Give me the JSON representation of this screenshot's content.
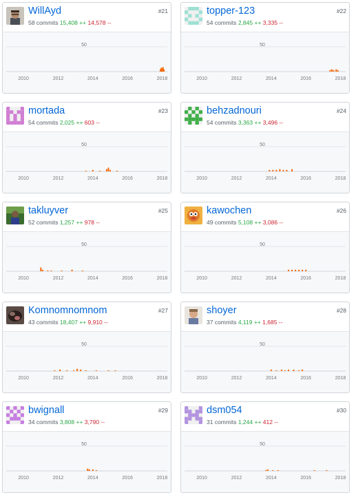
{
  "contributors": [
    {
      "rank": "#21",
      "name": "WillAyd",
      "commits": "58 commits",
      "additions": "15,408 ++",
      "deletions": "14,578 --",
      "avatar": "photo-avatar-icon"
    },
    {
      "rank": "#22",
      "name": "topper-123",
      "commits": "54 commits",
      "additions": "2,845 ++",
      "deletions": "3,335 --",
      "avatar": "identicon-avatar-icon"
    },
    {
      "rank": "#23",
      "name": "mortada",
      "commits": "54 commits",
      "additions": "2,025 ++",
      "deletions": "603 --",
      "avatar": "identicon-avatar-icon"
    },
    {
      "rank": "#24",
      "name": "behzadnouri",
      "commits": "54 commits",
      "additions": "3,363 ++",
      "deletions": "3,496 --",
      "avatar": "identicon-avatar-icon"
    },
    {
      "rank": "#25",
      "name": "takluyver",
      "commits": "52 commits",
      "additions": "1,257 ++",
      "deletions": "978 --",
      "avatar": "photo-avatar-icon"
    },
    {
      "rank": "#26",
      "name": "kawochen",
      "commits": "49 commits",
      "additions": "5,108 ++",
      "deletions": "3,086 --",
      "avatar": "photo-avatar-icon"
    },
    {
      "rank": "#27",
      "name": "Komnomnomnom",
      "commits": "43 commits",
      "additions": "18,407 ++",
      "deletions": "9,910 --",
      "avatar": "photo-avatar-icon"
    },
    {
      "rank": "#28",
      "name": "shoyer",
      "commits": "37 commits",
      "additions": "4,119 ++",
      "deletions": "1,685 --",
      "avatar": "photo-avatar-icon"
    },
    {
      "rank": "#29",
      "name": "bwignall",
      "commits": "34 commits",
      "additions": "3,808 ++",
      "deletions": "3,790 --",
      "avatar": "identicon-avatar-icon"
    },
    {
      "rank": "#30",
      "name": "dsm054",
      "commits": "31 commits",
      "additions": "1,244 ++",
      "deletions": "412 --",
      "avatar": "identicon-avatar-icon"
    }
  ],
  "chart_data": {
    "type": "area",
    "x_ticks": [
      "2010",
      "2012",
      "2014",
      "2016",
      "2018"
    ],
    "y_ticks": [
      "50"
    ],
    "xlim": [
      2009.0,
      2018.3
    ],
    "ylim": [
      0,
      80
    ],
    "series": [
      {
        "activity": [
          [
            2017.9,
            3
          ],
          [
            2017.95,
            5
          ],
          [
            2018.0,
            4
          ],
          [
            2018.05,
            6
          ],
          [
            2018.1,
            3
          ]
        ]
      },
      {
        "activity": [
          [
            2017.4,
            2
          ],
          [
            2017.5,
            3
          ],
          [
            2017.6,
            2
          ],
          [
            2017.75,
            3
          ],
          [
            2017.85,
            2
          ]
        ]
      },
      {
        "activity": [
          [
            2013.6,
            1
          ],
          [
            2014.0,
            2
          ],
          [
            2014.4,
            1
          ],
          [
            2014.8,
            3
          ],
          [
            2014.9,
            5
          ],
          [
            2015.0,
            2
          ],
          [
            2015.4,
            1
          ]
        ]
      },
      {
        "activity": [
          [
            2013.9,
            2
          ],
          [
            2014.1,
            2
          ],
          [
            2014.3,
            2
          ],
          [
            2014.5,
            3
          ],
          [
            2014.7,
            2
          ],
          [
            2014.9,
            2
          ],
          [
            2015.2,
            3
          ]
        ]
      },
      {
        "activity": [
          [
            2011.0,
            5
          ],
          [
            2011.1,
            2
          ],
          [
            2011.4,
            1
          ],
          [
            2011.6,
            1
          ],
          [
            2012.2,
            1
          ],
          [
            2012.8,
            2
          ],
          [
            2013.4,
            1
          ]
        ]
      },
      {
        "activity": [
          [
            2015.0,
            2
          ],
          [
            2015.2,
            2
          ],
          [
            2015.4,
            2
          ],
          [
            2015.6,
            2
          ],
          [
            2015.8,
            2
          ],
          [
            2016.0,
            2
          ]
        ]
      },
      {
        "activity": [
          [
            2011.8,
            1
          ],
          [
            2012.1,
            2
          ],
          [
            2012.5,
            1
          ],
          [
            2012.9,
            1
          ],
          [
            2013.1,
            3
          ],
          [
            2013.3,
            2
          ],
          [
            2013.6,
            1
          ],
          [
            2014.2,
            1
          ],
          [
            2014.9,
            1
          ],
          [
            2015.3,
            1
          ]
        ]
      },
      {
        "activity": [
          [
            2014.0,
            2
          ],
          [
            2014.3,
            1
          ],
          [
            2014.6,
            2
          ],
          [
            2014.8,
            1
          ],
          [
            2015.0,
            2
          ],
          [
            2015.3,
            2
          ],
          [
            2015.6,
            1
          ],
          [
            2015.8,
            2
          ]
        ]
      },
      {
        "activity": [
          [
            2013.7,
            3
          ],
          [
            2013.8,
            2
          ],
          [
            2014.0,
            2
          ],
          [
            2014.2,
            1
          ]
        ]
      },
      {
        "activity": [
          [
            2013.7,
            1
          ],
          [
            2013.8,
            2
          ],
          [
            2014.1,
            1
          ],
          [
            2014.4,
            1
          ],
          [
            2016.5,
            1
          ],
          [
            2017.2,
            1
          ]
        ]
      }
    ]
  },
  "colors": {
    "link": "#0366d6",
    "additions": "#28a745",
    "deletions": "#cb2431",
    "activity": "#f66a0a",
    "grid": "#e1e4e8"
  }
}
